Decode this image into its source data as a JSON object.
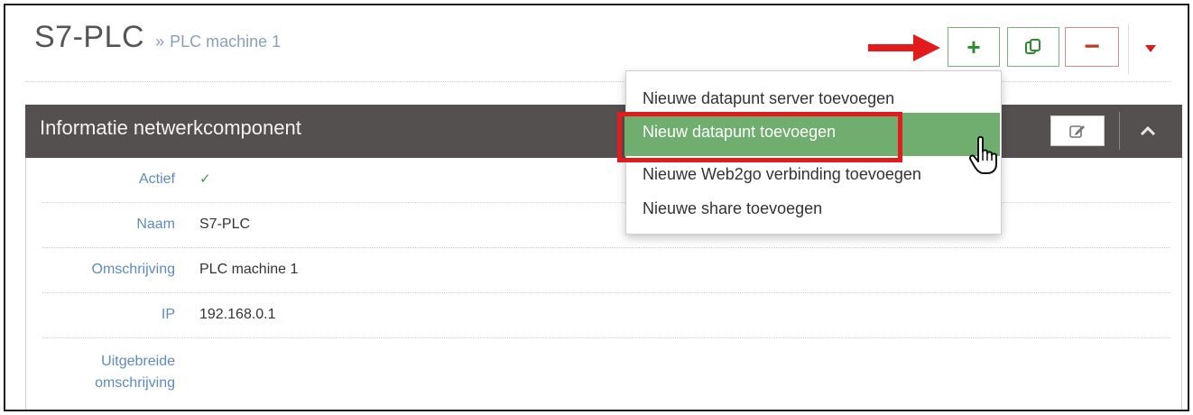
{
  "header": {
    "title": "S7-PLC",
    "separator": "»",
    "subtitle": "PLC machine 1"
  },
  "toolbar": {
    "add_label": "+",
    "copy_icon": "copy-icon",
    "remove_label": "−",
    "dropdown_icon": "caret-down-icon"
  },
  "dropdown": {
    "items": [
      "Nieuwe datapunt server toevoegen",
      "Nieuw datapunt toevoegen",
      "Nieuwe Web2go verbinding toevoegen",
      "Nieuwe share toevoegen"
    ],
    "active_index": 1
  },
  "panel": {
    "title": "Informatie netwerkcomponent",
    "edit_icon": "edit-icon",
    "collapse_icon": "chevron-up-icon"
  },
  "fields": {
    "actief": {
      "label": "Actief",
      "value": "✓"
    },
    "naam": {
      "label": "Naam",
      "value": "S7-PLC"
    },
    "omschrijving": {
      "label": "Omschrijving",
      "value": "PLC machine 1"
    },
    "ip": {
      "label": "IP",
      "value": "192.168.0.1"
    },
    "uitgebreide": {
      "label_line1": "Uitgebreide",
      "label_line2": "omschrijving",
      "value": ""
    }
  },
  "colors": {
    "panel_header_bg": "#555050",
    "active_item_bg": "#6fae6f",
    "highlight_red": "#e21c1c",
    "label_blue": "#5b8bbf",
    "add_green": "#2c8a2c",
    "remove_red": "#c0392b"
  }
}
